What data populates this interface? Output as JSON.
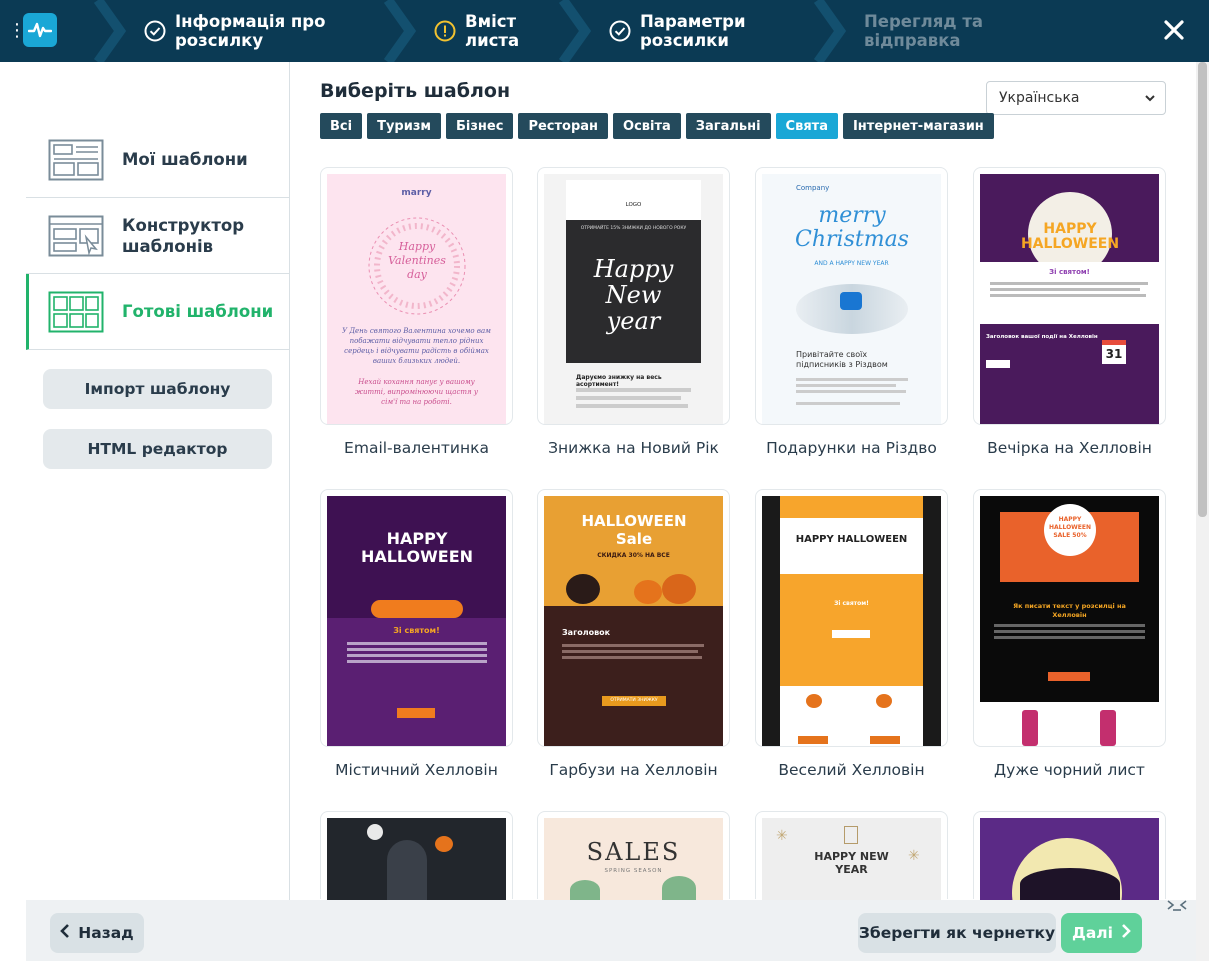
{
  "stepper": {
    "steps": [
      {
        "label": "Інформація про розсилку",
        "status": "done"
      },
      {
        "label": "Вміст листа",
        "status": "warning"
      },
      {
        "label": "Параметри розсилки",
        "status": "done"
      },
      {
        "label": "Перегляд та відправка",
        "status": "pending"
      }
    ],
    "icons": {
      "done": "check-circle-icon",
      "warning": "warning-circle-icon",
      "close": "close-icon",
      "logo": "pulse-logo-icon"
    }
  },
  "sidebar": {
    "items": [
      {
        "label": "Мої шаблони",
        "icon": "template-layout-icon"
      },
      {
        "label": "Конструктор шаблонів",
        "icon": "template-builder-icon"
      },
      {
        "label": "Готові шаблони",
        "icon": "ready-templates-icon",
        "active": true
      }
    ],
    "import_label": "Імпорт шаблону",
    "html_label": "HTML редактор"
  },
  "main": {
    "title": "Виберіть шаблон",
    "language": "Українська",
    "filters": [
      {
        "label": "Всі"
      },
      {
        "label": "Туризм"
      },
      {
        "label": "Бізнес"
      },
      {
        "label": "Ресторан"
      },
      {
        "label": "Освіта"
      },
      {
        "label": "Загальні"
      },
      {
        "label": "Свята",
        "active": true
      },
      {
        "label": "Інтернет-магазин"
      }
    ],
    "templates": [
      {
        "label": "Email-валентинка",
        "theme": "t-val"
      },
      {
        "label": "Знижка на Новий Рік",
        "theme": "t-ny"
      },
      {
        "label": "Подарунки на Різдво",
        "theme": "t-xmas"
      },
      {
        "label": "Вечірка на Хелловін",
        "theme": "t-hall1"
      },
      {
        "label": "Містичний Хелловін",
        "theme": "t-myst"
      },
      {
        "label": "Гарбузи на Хелловін",
        "theme": "t-pump"
      },
      {
        "label": "Веселий Хелловін",
        "theme": "t-fun"
      },
      {
        "label": "Дуже чорний лист",
        "theme": "t-black"
      },
      {
        "label": "",
        "theme": "t-dark"
      },
      {
        "label": "",
        "theme": "t-sales"
      },
      {
        "label": "",
        "theme": "t-hny"
      },
      {
        "label": "",
        "theme": "t-hall2"
      }
    ],
    "thumb_text": {
      "val_brand": "marry",
      "val_script": "Happy Valentines day",
      "val_body": "У День святого Валентина хочемо вам побажати відчувати тепло рідних сердець і відчувати радість в обіймах ваших близьких людей.",
      "val_wish": "Нехай кохання панує у вашому житті, випромінюючи щастя у сім'ї та на роботі.",
      "ny_logo": "LOGO",
      "ny_banner": "ОТРИМАЙТЕ 15% ЗНИЖКИ ДО НОВОГО РОКУ",
      "ny_script": "Happy New year",
      "ny_heading": "Даруємо знижку на весь асортимент!",
      "xmas_company": "Company",
      "xmas_script": "merry Christmas",
      "xmas_sub": "AND A HAPPY NEW YEAR",
      "xmas_heading": "Привітайте своїх підписників з Різдвом",
      "hall1_title": "HAPPY HALLOWEEN",
      "hall1_sub": "Зі святом!",
      "hall1_sec": "Заголовок вашої події на Хелловін",
      "hall1_day": "31",
      "myst_title": "HAPPY HALLOWEEN",
      "myst_sub": "Зі святом!",
      "pump_title": "HALLOWEEN Sale",
      "pump_sub": "СКИДКА 30% НА ВСЕ",
      "pump_heading": "Заголовок",
      "pump_btn": "ОТРИМАТИ ЗНИЖКУ",
      "fun_title": "HAPPY HALLOWEEN",
      "fun_sub": "Зі святом!",
      "black_sale": "HAPPY HALLOWEEN SALE 50%",
      "black_heading": "Як писати текст у розсилці на Хелловін",
      "sales_title": "SALES",
      "sales_sub": "SPRING SEASON",
      "hny_title": "HAPPY NEW YEAR"
    }
  },
  "footer": {
    "back_label": "Назад",
    "draft_label": "Зберегти як чернетку",
    "next_label": "Далі"
  }
}
